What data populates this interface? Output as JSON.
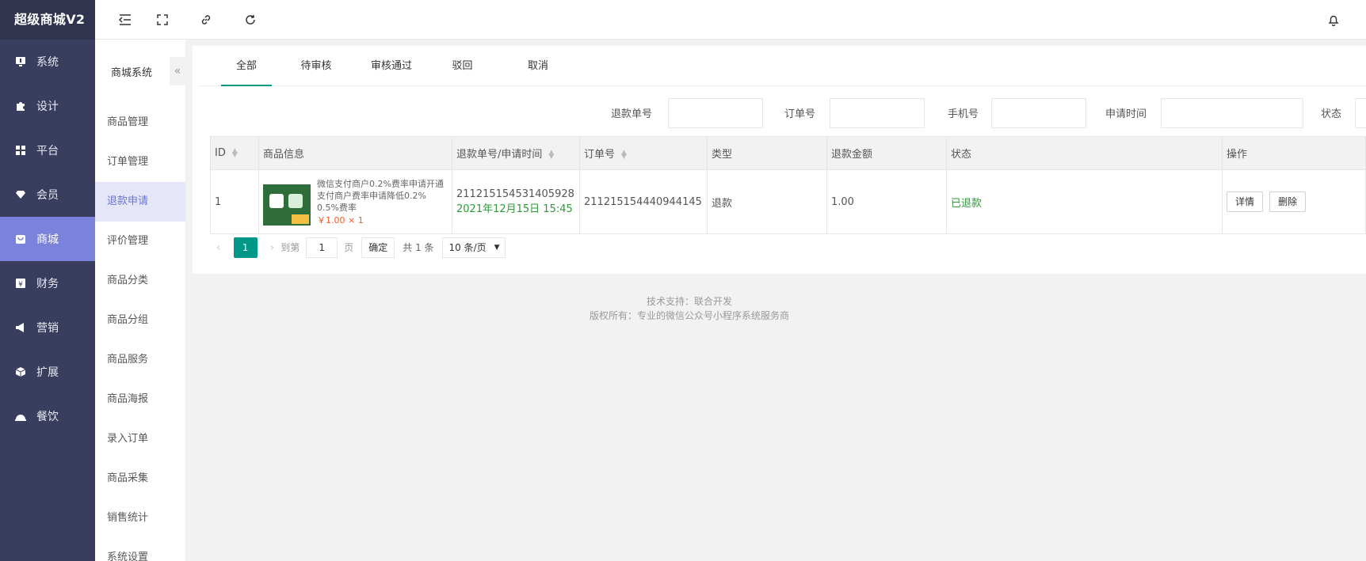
{
  "app": {
    "title": "超级商城V2"
  },
  "sidebar": {
    "items": [
      {
        "label": "系统"
      },
      {
        "label": "设计"
      },
      {
        "label": "平台"
      },
      {
        "label": "会员"
      },
      {
        "label": "商城"
      },
      {
        "label": "财务"
      },
      {
        "label": "营销"
      },
      {
        "label": "扩展"
      },
      {
        "label": "餐饮"
      }
    ],
    "active_index": 4
  },
  "subnav": {
    "title": "商城系统",
    "items": [
      {
        "label": "商品管理"
      },
      {
        "label": "订单管理"
      },
      {
        "label": "退款申请"
      },
      {
        "label": "评价管理"
      },
      {
        "label": "商品分类"
      },
      {
        "label": "商品分组"
      },
      {
        "label": "商品服务"
      },
      {
        "label": "商品海报"
      },
      {
        "label": "录入订单"
      },
      {
        "label": "商品采集"
      },
      {
        "label": "销售统计"
      },
      {
        "label": "系统设置"
      }
    ],
    "active_index": 2
  },
  "tabs": [
    {
      "label": "全部"
    },
    {
      "label": "待审核"
    },
    {
      "label": "审核通过"
    },
    {
      "label": "驳回"
    },
    {
      "label": "取消"
    }
  ],
  "filters": {
    "refund_no": {
      "label": "退款单号",
      "value": ""
    },
    "order_no": {
      "label": "订单号",
      "value": ""
    },
    "phone": {
      "label": "手机号",
      "value": ""
    },
    "apply_time": {
      "label": "申请时间",
      "value": ""
    },
    "status": {
      "label": "状态"
    }
  },
  "table": {
    "headers": [
      "ID",
      "商品信息",
      "退款单号/申请时间",
      "订单号",
      "类型",
      "退款金额",
      "状态",
      "操作"
    ],
    "rows": [
      {
        "id": "1",
        "goods_name": "微信支付商户0.2%费率申请开通支付商户费率申请降低0.2% 0.5%费率",
        "goods_price": "￥1.00 × 1",
        "refund_no": "211215154531405928",
        "apply_time": "2021年12月15日 15:45",
        "order_no": "211215154440944145",
        "type": "退款",
        "amount": "1.00",
        "status": "已退款",
        "actions": [
          "详情",
          "删除"
        ]
      }
    ]
  },
  "pager": {
    "current": "1",
    "goto_label": "到第",
    "goto_value": "1",
    "page_unit": "页",
    "confirm": "确定",
    "total": "共 1 条",
    "page_size": "10 条/页"
  },
  "footer": {
    "line1": "技术支持：联合开发",
    "line2": "版权所有：专业的微信公众号小程序系统服务商"
  },
  "colors": {
    "sidebar_bg": "#393d5e",
    "sidebar_active": "#7a82db",
    "accent": "#009688",
    "status_green": "#2e9a3a",
    "price_red": "#ff5722"
  }
}
